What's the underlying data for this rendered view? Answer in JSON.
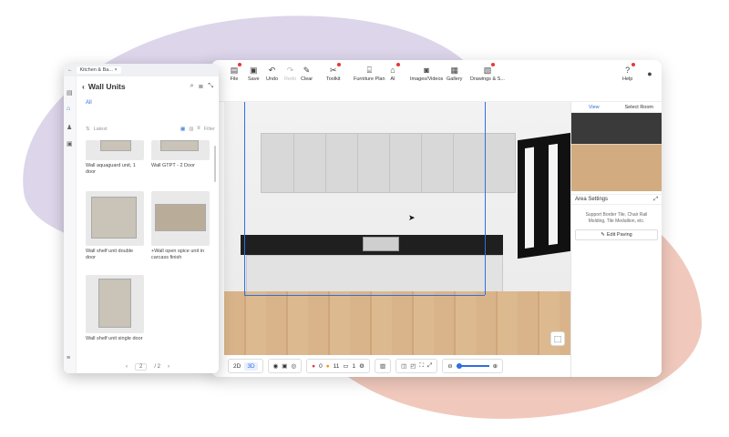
{
  "toolbar": {
    "items": [
      {
        "label": "File",
        "icon": "file-icon",
        "dot": true
      },
      {
        "label": "Save",
        "icon": "save-icon"
      },
      {
        "label": "Undo",
        "icon": "undo-icon"
      },
      {
        "label": "Redo",
        "icon": "redo-icon",
        "disabled": true
      },
      {
        "label": "Clear",
        "icon": "clear-icon"
      },
      {
        "label": "Toolkit",
        "icon": "toolkit-icon",
        "dot": true
      },
      {
        "label": "Furniture Plan",
        "icon": "furniture-plan-icon"
      },
      {
        "label": "AI",
        "icon": "ai-icon",
        "dot": true
      },
      {
        "label": "Images/Videos",
        "icon": "camera-icon"
      },
      {
        "label": "Gallery",
        "icon": "gallery-icon"
      },
      {
        "label": "Drawings & S...",
        "icon": "drawings-icon",
        "dot": true
      },
      {
        "label": "Help",
        "icon": "help-icon",
        "dot": true
      }
    ]
  },
  "right_panel": {
    "tabs": [
      "View",
      "Select Room"
    ],
    "area_title": "Area Settings",
    "area_text": "Support Border Tile, Chair Rail Molding, Tile Medallion, etc.",
    "edit_button": "Edit Paving"
  },
  "bottom_bar": {
    "view_2d": "2D",
    "view_3d": "3D",
    "error_count": "0",
    "warning_count": "11",
    "layer_count": "1"
  },
  "catalog": {
    "tab_title": "Kitchen & Ba...",
    "title": "Wall Units",
    "filter_all": "All",
    "sort_label": "Latest",
    "filter_label": "Filter",
    "products": [
      {
        "name": "Wall aquaguard unit, 1 door"
      },
      {
        "name": "Wall GTPT - 2 Door"
      },
      {
        "name": "Wall shelf unit double door"
      },
      {
        "name": "+Wall open spice unit in carcass finish"
      },
      {
        "name": "Wall shelf unit single door"
      }
    ],
    "page_current": "2",
    "page_total": "/ 2"
  },
  "colors": {
    "accent": "#2f6fe0",
    "blob_purple": "#ddd5ea",
    "blob_peach": "#f0c9bc",
    "countertop": "#1f1f1f"
  }
}
